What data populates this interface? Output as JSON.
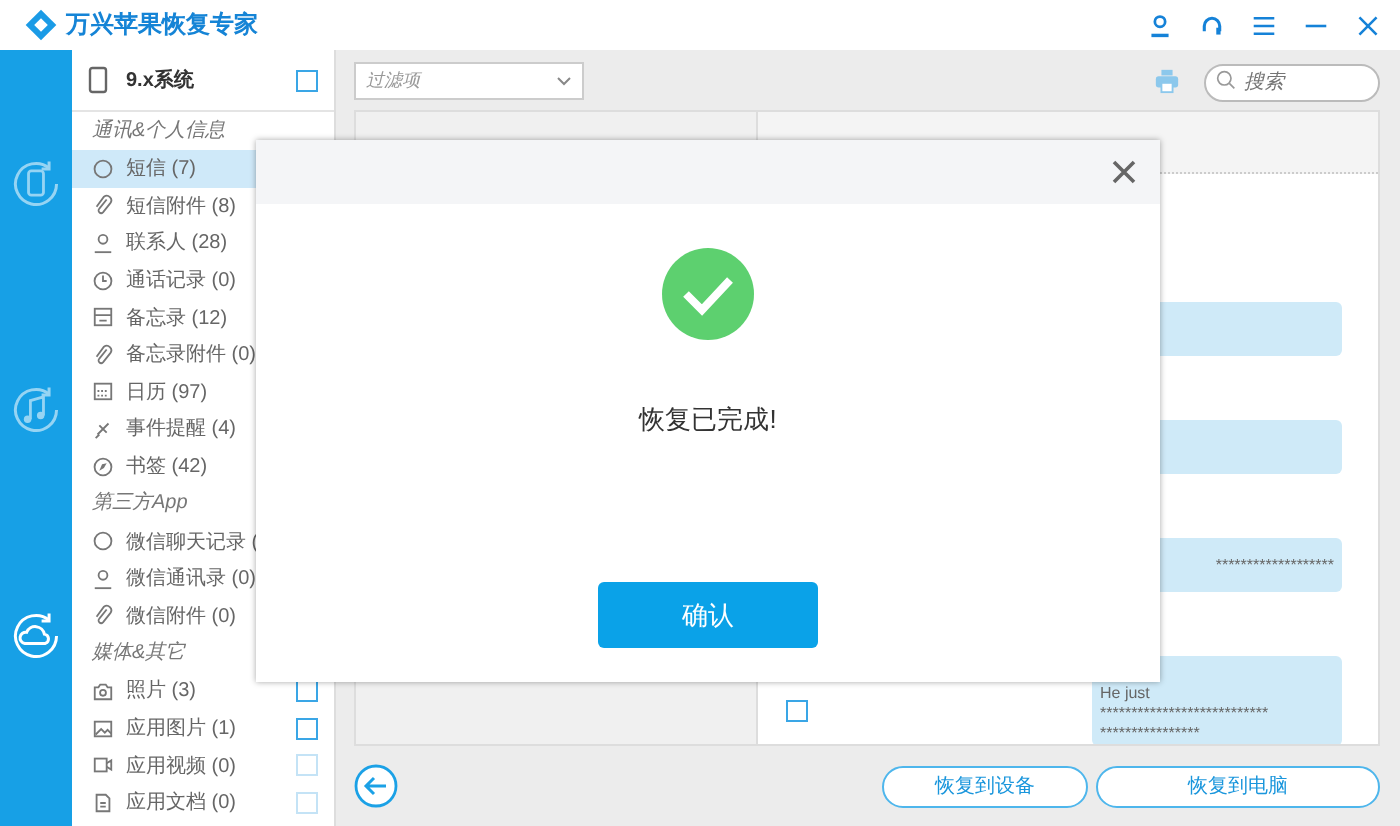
{
  "app": {
    "title": "万兴苹果恢复专家"
  },
  "rail": [
    {
      "selected": false
    },
    {
      "selected": false
    },
    {
      "selected": true
    }
  ],
  "device": {
    "label": "9.x系统",
    "checked": false
  },
  "sidebar": [
    {
      "heading": "通讯&个人信息",
      "items": [
        {
          "label": "短信 (7)",
          "selected": true
        },
        {
          "label": "短信附件 (8)",
          "selected": false
        },
        {
          "label": "联系人 (28)",
          "selected": false
        },
        {
          "label": "通话记录 (0)",
          "selected": false
        },
        {
          "label": "备忘录 (12)",
          "selected": false
        },
        {
          "label": "备忘录附件 (0)",
          "selected": false
        },
        {
          "label": "日历 (97)",
          "selected": false
        },
        {
          "label": "事件提醒 (4)",
          "selected": false
        },
        {
          "label": "书签 (42)",
          "selected": false
        }
      ]
    },
    {
      "heading": "第三方App",
      "items": [
        {
          "label": "微信聊天记录 (",
          "selected": false
        },
        {
          "label": "微信通讯录 (0)",
          "selected": false
        },
        {
          "label": "微信附件 (0)",
          "selected": false
        }
      ]
    },
    {
      "heading": "媒体&其它",
      "items": [
        {
          "label": "照片 (3)",
          "selected": false,
          "checked": false,
          "disabled": false
        },
        {
          "label": "应用图片 (1)",
          "selected": false,
          "checked": false,
          "disabled": false
        },
        {
          "label": "应用视频 (0)",
          "selected": false,
          "checked": false,
          "disabled": true
        },
        {
          "label": "应用文档 (0)",
          "selected": false,
          "checked": false,
          "disabled": true
        }
      ]
    }
  ],
  "filter": {
    "placeholder": "过滤项"
  },
  "search": {
    "placeholder": "搜索"
  },
  "messages": [
    {
      "kind": "blank"
    },
    {
      "kind": "blank"
    },
    {
      "kind": "text",
      "lines": [
        "*******************"
      ]
    },
    {
      "kind": "text",
      "lines": [
        "He just",
        "***************************",
        "****************"
      ]
    }
  ],
  "message_checked": false,
  "buttons": [
    "恢复到设备",
    "恢复到电脑"
  ],
  "dialog": {
    "message": "恢复已完成!",
    "button": "确认"
  }
}
